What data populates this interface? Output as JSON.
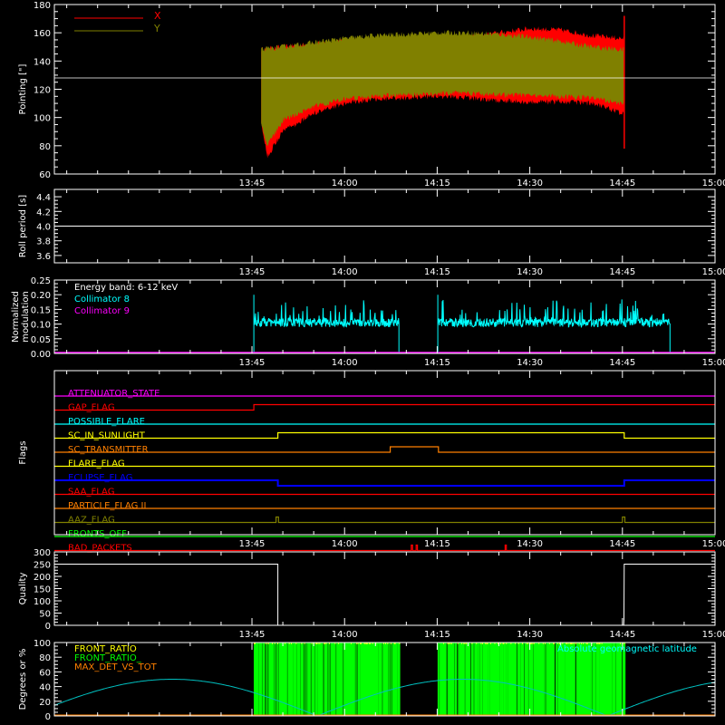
{
  "x_axis": {
    "ticks": [
      "13:45",
      "14:00",
      "14:15",
      "14:30",
      "14:45",
      "15:00"
    ],
    "tick_minutes": [
      825,
      840,
      855,
      870,
      885,
      900
    ],
    "range_minutes": [
      793,
      900
    ]
  },
  "chart_data": [
    {
      "id": "pointing",
      "type": "area",
      "ylabel": "Pointing [\"]",
      "ylim": [
        60,
        180
      ],
      "yticks": [
        60,
        80,
        100,
        120,
        140,
        160,
        180
      ],
      "legend": [
        "X",
        "Y"
      ],
      "legend_position": "top-left",
      "reference_line": 128,
      "time_range_minutes": [
        826.5,
        885.3
      ],
      "series": [
        {
          "name": "X",
          "color": "#ff0000",
          "upper": [
            [
              826.5,
              148
            ],
            [
              830,
              150
            ],
            [
              835,
              152
            ],
            [
              840,
              154
            ],
            [
              845,
              155
            ],
            [
              850,
              155
            ],
            [
              855,
              155
            ],
            [
              860,
              157
            ],
            [
              865,
              160
            ],
            [
              870,
              163
            ],
            [
              875,
              162
            ],
            [
              880,
              158
            ],
            [
              885,
              156
            ]
          ],
          "lower": [
            [
              826.5,
              95
            ],
            [
              827.5,
              72
            ],
            [
              830,
              90
            ],
            [
              835,
              103
            ],
            [
              840,
              110
            ],
            [
              845,
              113
            ],
            [
              850,
              114
            ],
            [
              855,
              115
            ],
            [
              860,
              114
            ],
            [
              865,
              112
            ],
            [
              870,
              111
            ],
            [
              875,
              111
            ],
            [
              880,
              110
            ],
            [
              885,
              103
            ]
          ]
        },
        {
          "name": "Y",
          "color": "#808000",
          "upper": [
            [
              826.5,
              148
            ],
            [
              830,
              150
            ],
            [
              835,
              153
            ],
            [
              840,
              156
            ],
            [
              845,
              158
            ],
            [
              850,
              159
            ],
            [
              855,
              160
            ],
            [
              860,
              160
            ],
            [
              865,
              159
            ],
            [
              870,
              157
            ],
            [
              875,
              154
            ],
            [
              880,
              150
            ],
            [
              885,
              148
            ]
          ],
          "lower": [
            [
              826.5,
              95
            ],
            [
              827.5,
              80
            ],
            [
              830,
              98
            ],
            [
              835,
              108
            ],
            [
              840,
              113
            ],
            [
              845,
              115
            ],
            [
              850,
              116
            ],
            [
              855,
              117
            ],
            [
              860,
              117
            ],
            [
              865,
              116
            ],
            [
              870,
              116
            ],
            [
              875,
              115
            ],
            [
              880,
              114
            ],
            [
              885,
              110
            ]
          ]
        }
      ]
    },
    {
      "id": "roll-period",
      "type": "line",
      "ylabel": "Roll period [s]",
      "ylim": [
        3.5,
        4.5
      ],
      "yticks": [
        3.6,
        3.8,
        4.0,
        4.2,
        4.4
      ],
      "ytick_labels": [
        "3.6",
        "3.8",
        "4.0",
        "4.2",
        "4.4"
      ],
      "series": [
        {
          "name": "",
          "color": "#ffffff",
          "values": [
            [
              793,
              4.0
            ],
            [
              900,
              4.0
            ]
          ]
        }
      ]
    },
    {
      "id": "modulation",
      "type": "line",
      "ylabel": "Normalized modulation",
      "ylim": [
        0,
        0.25
      ],
      "yticks": [
        0,
        0.05,
        0.1,
        0.15,
        0.2,
        0.25
      ],
      "ytick_labels": [
        "0.00",
        "0.05",
        "0.10",
        "0.15",
        "0.20",
        "0.25"
      ],
      "annotation": "Energy band: 6-12 keV",
      "legend": [
        "Collimator 8",
        "Collimator 9"
      ],
      "series": [
        {
          "name": "Collimator 8",
          "color": "#00ffff",
          "base": 0.105,
          "segments": [
            [
              825.3,
              848.8
            ],
            [
              855.1,
              892.7
            ]
          ]
        },
        {
          "name": "Collimator 9",
          "color": "#ff00ff",
          "values": [
            [
              793,
              0.0
            ],
            [
              900,
              0.0
            ]
          ]
        }
      ]
    },
    {
      "id": "flags",
      "type": "line",
      "ylabel": "Flags",
      "flags": [
        {
          "name": "ATTENUATOR_STATE",
          "color": "#ff00ff",
          "transitions": []
        },
        {
          "name": "GAP_FLAG",
          "color": "#ff0000",
          "transitions": [
            [
              825.3,
              1
            ],
            [
              892.7,
              1
            ]
          ]
        },
        {
          "name": "POSSIBLE_FLARE",
          "color": "#00ffff",
          "transitions": []
        },
        {
          "name": "SC_IN_SUNLIGHT",
          "color": "#ffff00",
          "transitions": [
            [
              829.2,
              1
            ],
            [
              885.3,
              0
            ]
          ]
        },
        {
          "name": "SC_TRANSMITTER",
          "color": "#ff8000",
          "transitions": [
            [
              847.4,
              1
            ],
            [
              855.2,
              0
            ]
          ]
        },
        {
          "name": "FLARE_FLAG",
          "color": "#ffff00",
          "transitions": []
        },
        {
          "name": "ECLIPSE_FLAG",
          "color": "#0000ff",
          "transitions": [
            [
              829.2,
              -1
            ],
            [
              885.3,
              0
            ]
          ]
        },
        {
          "name": "SAA_FLAG",
          "color": "#ff0000",
          "transitions": []
        },
        {
          "name": "PARTICLE_FLAG II",
          "color": "#ff8000",
          "transitions": []
        },
        {
          "name": "AAZ_FLAG",
          "color": "#808000",
          "pulses": [
            [
              828.9,
              829.3
            ],
            [
              885.0,
              885.4
            ]
          ]
        },
        {
          "name": "FRONTS_OFF",
          "color": "#00ff00",
          "transitions": []
        },
        {
          "name": "BAD_PACKETS",
          "color": "#ff0000",
          "pulses": [
            [
              850.8,
              851.0
            ],
            [
              851.6,
              851.8
            ],
            [
              866.0,
              866.2
            ]
          ]
        }
      ]
    },
    {
      "id": "quality",
      "type": "line",
      "ylabel": "Quality",
      "ylim": [
        0,
        300
      ],
      "yticks": [
        0,
        50,
        100,
        150,
        200,
        250,
        300
      ],
      "series": [
        {
          "name": "",
          "color": "#ffffff",
          "values": [
            [
              793,
              250
            ],
            [
              829.2,
              250
            ],
            [
              829.2,
              0
            ],
            [
              885.2,
              0
            ],
            [
              885.25,
              20
            ],
            [
              885.3,
              250
            ],
            [
              900,
              250
            ]
          ]
        }
      ]
    },
    {
      "id": "geomagnetic",
      "type": "area",
      "ylabel": "Degrees or %",
      "ylim": [
        0,
        100
      ],
      "yticks": [
        0,
        20,
        40,
        60,
        80,
        100
      ],
      "legend": [
        "FRONT_RATIO",
        "FRONT_RATIO_",
        "MAX_DET_VS_TOT",
        "Absolute geomagnetic latitude"
      ],
      "series": [
        {
          "name": "FRONT_RATIO",
          "color": "#ffff00"
        },
        {
          "name": "FRONT_RATIO_",
          "color": "#00ff00",
          "segments": [
            [
              825.3,
              848.8
            ],
            [
              855.1,
              885.3
            ]
          ]
        },
        {
          "name": "MAX_DET_VS_TOT",
          "color": "#ff8000"
        },
        {
          "name": "Absolute geomagnetic latitude",
          "color": "#00c0c0",
          "amplitude": 50,
          "period_minutes": 47,
          "zero_minute": 835.6
        }
      ]
    }
  ]
}
